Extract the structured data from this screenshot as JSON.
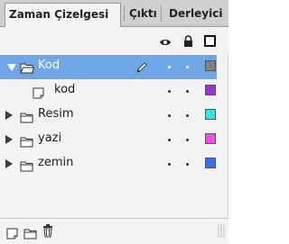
{
  "tabs": [
    {
      "label": "Zaman Çizelgesi",
      "active": true
    },
    {
      "label": "Çıktı",
      "active": false
    },
    {
      "label": "Derleyici",
      "active": false
    }
  ],
  "header_icons": [
    "eye-icon",
    "lock-icon",
    "outline-square-icon"
  ],
  "layers": [
    {
      "name": "Kod",
      "type": "folder",
      "expanded": true,
      "selected": true,
      "color": "#808080",
      "editing": true
    },
    {
      "name": "kod",
      "type": "layer",
      "selected": false,
      "color": "#9b34d3"
    },
    {
      "name": "Resim",
      "type": "folder",
      "expanded": false,
      "selected": false,
      "color": "#2de6e6"
    },
    {
      "name": "yazi",
      "type": "folder",
      "expanded": false,
      "selected": false,
      "color": "#f34ce8"
    },
    {
      "name": "zemin",
      "type": "folder",
      "expanded": false,
      "selected": false,
      "color": "#3a6df0"
    }
  ],
  "footer_icons": [
    "new-layer-icon",
    "new-folder-icon",
    "delete-icon"
  ]
}
